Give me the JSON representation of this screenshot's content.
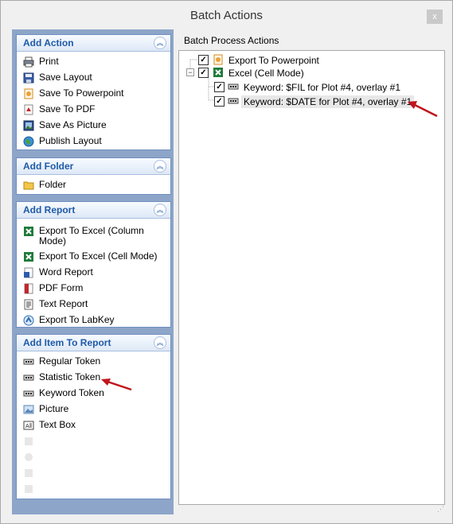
{
  "window": {
    "title": "Batch Actions",
    "close_glyph": "x"
  },
  "groups": {
    "add_action": {
      "title": "Add Action",
      "items": [
        {
          "label": "Print",
          "icon": "printer-icon"
        },
        {
          "label": "Save Layout",
          "icon": "floppy-icon"
        },
        {
          "label": "Save To Powerpoint",
          "icon": "powerpoint-icon"
        },
        {
          "label": "Save To PDF",
          "icon": "pdf-icon"
        },
        {
          "label": "Save As Picture",
          "icon": "picture-icon"
        },
        {
          "label": "Publish Layout",
          "icon": "globe-icon"
        }
      ]
    },
    "add_folder": {
      "title": "Add Folder",
      "items": [
        {
          "label": "Folder",
          "icon": "folder-icon"
        }
      ]
    },
    "add_report": {
      "title": "Add Report",
      "items": [
        {
          "label": "Export To Excel (Column Mode)",
          "icon": "excel-icon"
        },
        {
          "label": "Export To Excel (Cell Mode)",
          "icon": "excel-icon"
        },
        {
          "label": "Word Report",
          "icon": "word-icon"
        },
        {
          "label": "PDF Form",
          "icon": "pdf-icon"
        },
        {
          "label": "Text Report",
          "icon": "text-icon"
        },
        {
          "label": "Export To LabKey",
          "icon": "labkey-icon"
        }
      ]
    },
    "add_item": {
      "title": "Add Item To Report",
      "items": [
        {
          "label": "Regular Token",
          "icon": "token-icon"
        },
        {
          "label": "Statistic Token",
          "icon": "token-icon"
        },
        {
          "label": "Keyword Token",
          "icon": "token-icon"
        },
        {
          "label": "Picture",
          "icon": "image-icon"
        },
        {
          "label": "Text Box",
          "icon": "textbox-icon"
        },
        {
          "label": "",
          "icon": "disabled-icon"
        },
        {
          "label": "",
          "icon": "disabled-icon"
        },
        {
          "label": "",
          "icon": "disabled-icon"
        },
        {
          "label": "",
          "icon": "disabled-icon"
        }
      ]
    }
  },
  "right": {
    "header": "Batch Process Actions",
    "tree": [
      {
        "label": "Export To Powerpoint",
        "checked": true
      },
      {
        "label": "Excel (Cell Mode)",
        "checked": true,
        "expanded": true
      },
      {
        "label": "Keyword: $FIL for Plot #4, overlay #1",
        "checked": true
      },
      {
        "label": "Keyword: $DATE for Plot #4, overlay #1",
        "checked": true,
        "selected": true
      }
    ]
  },
  "colors": {
    "accent": "#1e5aa8",
    "pane": "#8da5c8",
    "arrow": "#c0141c"
  }
}
